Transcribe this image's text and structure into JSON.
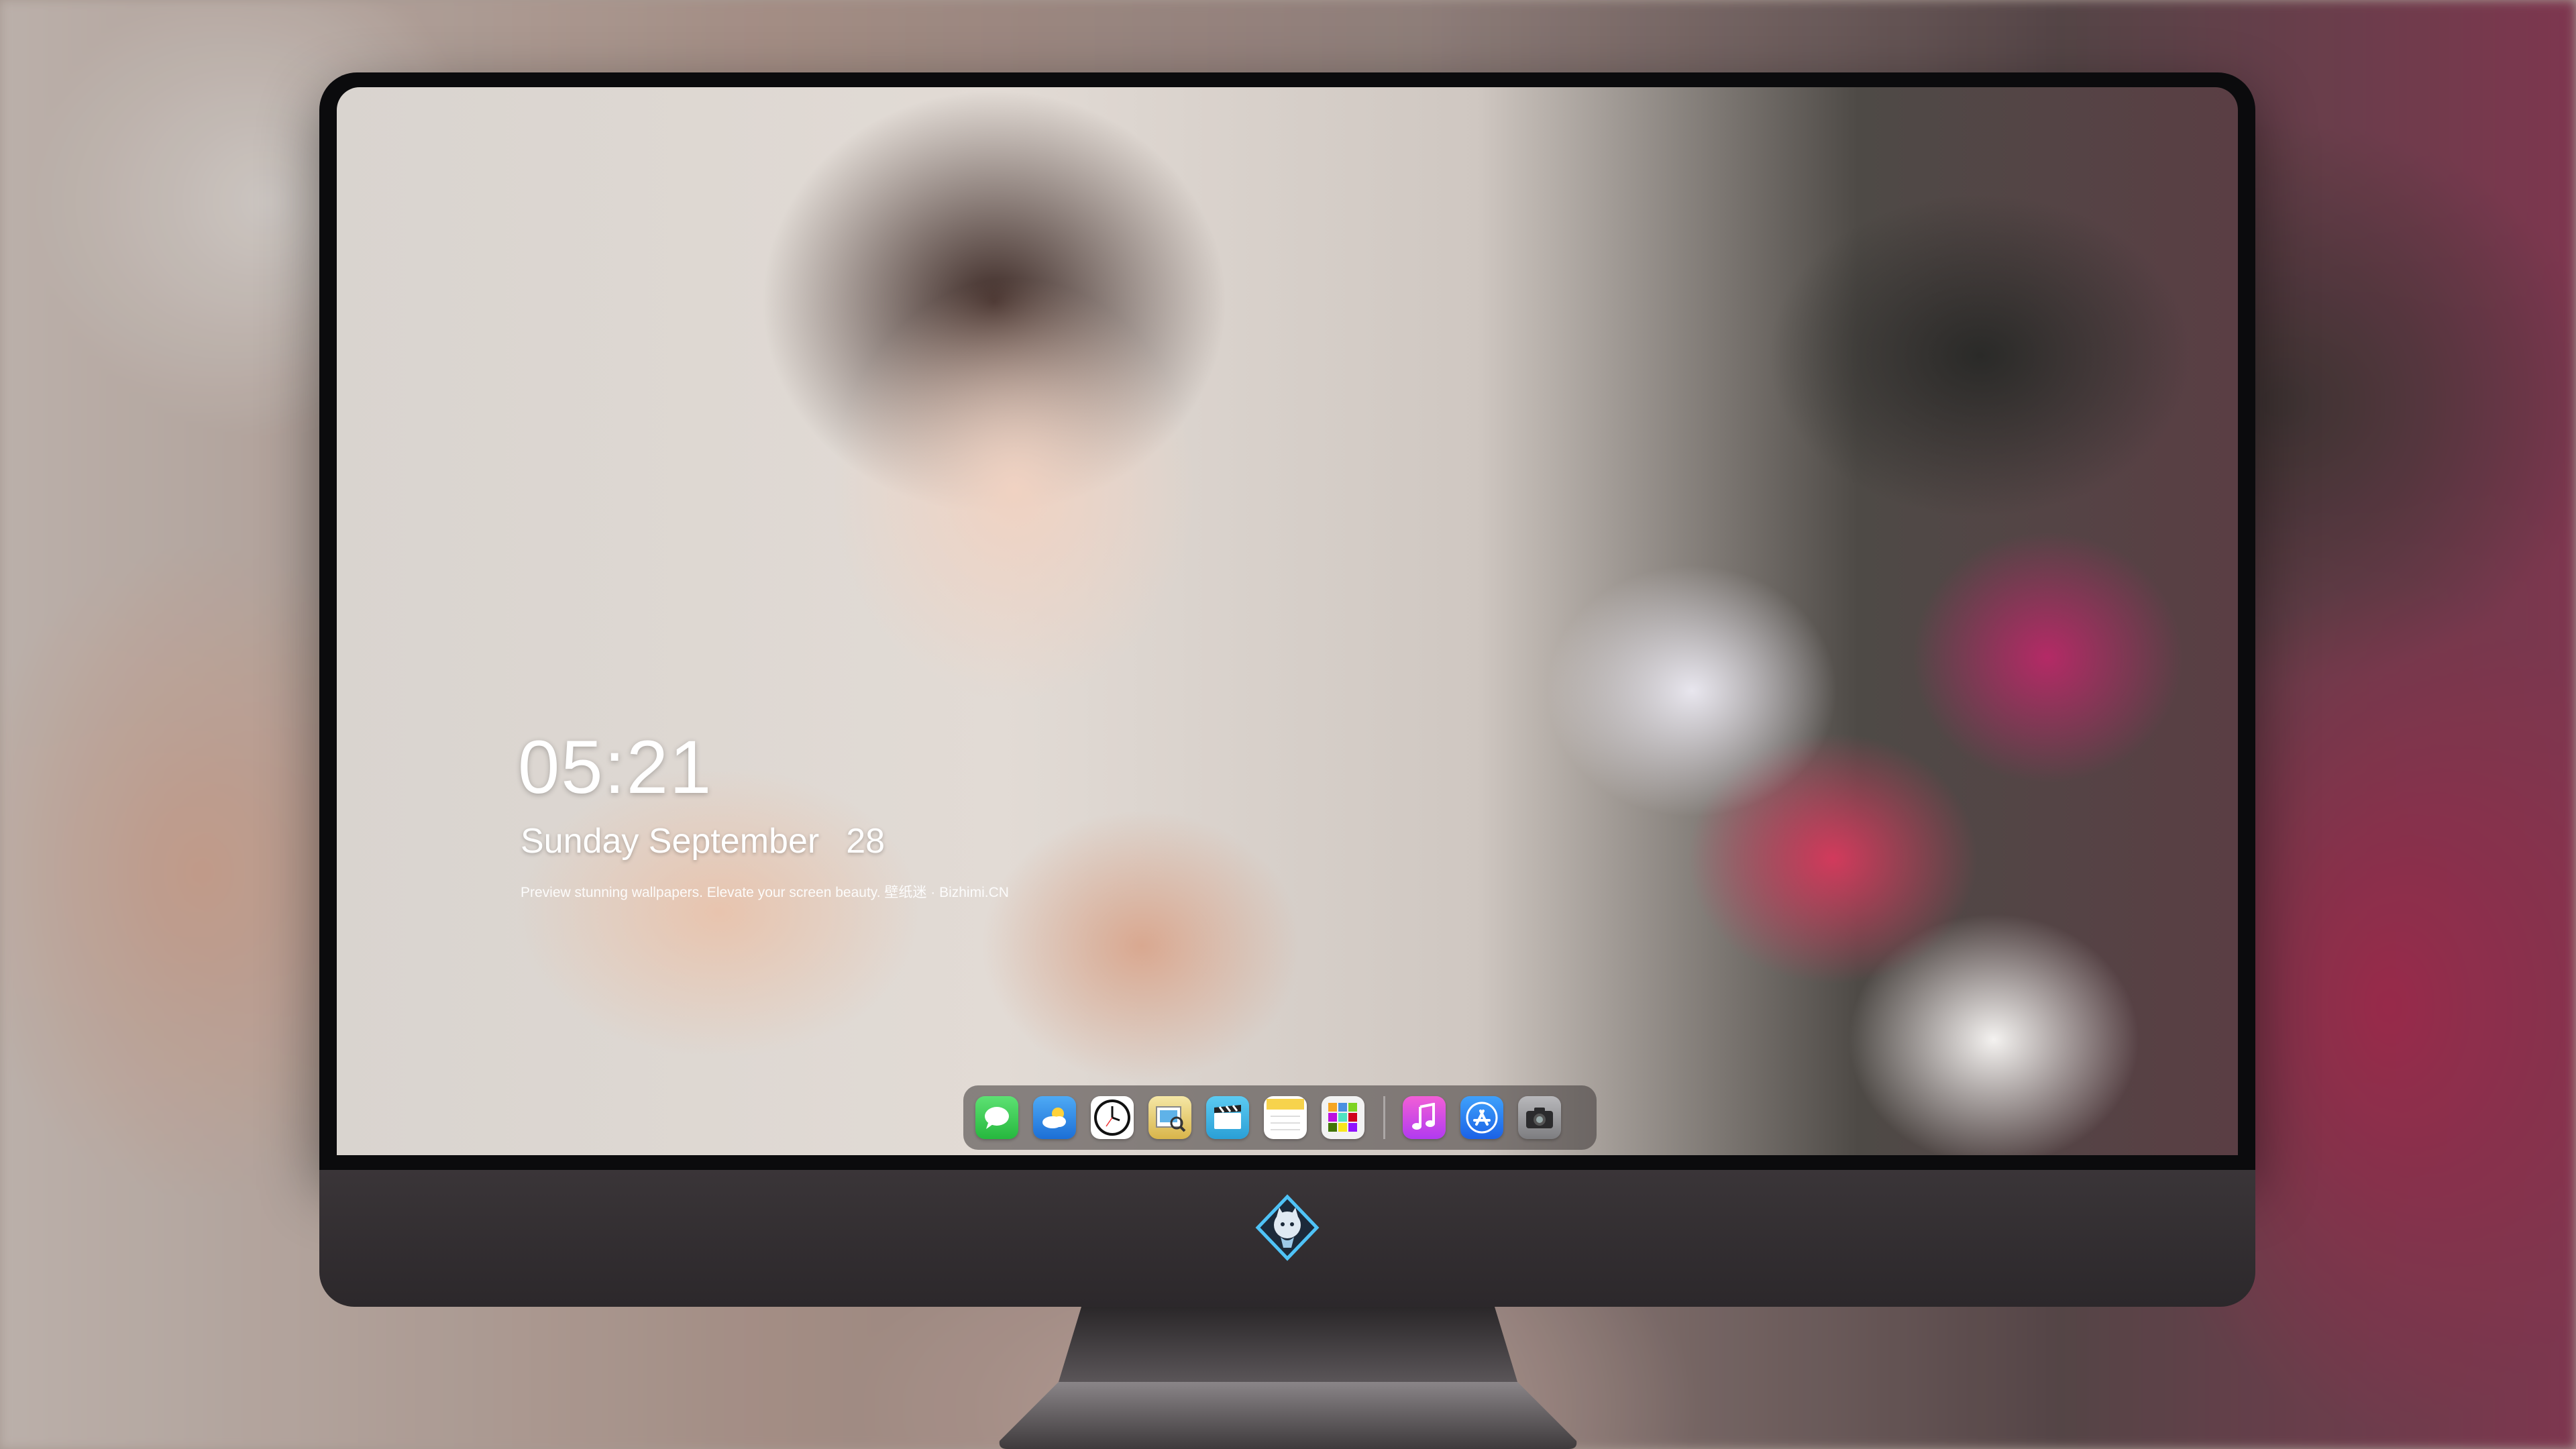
{
  "lockscreen": {
    "time": "05:21",
    "weekday_month": "Sunday September",
    "day": "28",
    "tagline": "Preview stunning wallpapers. Elevate your screen beauty. 壁纸迷 · Bizhimi.CN"
  },
  "dock": {
    "apps": [
      {
        "icon": "messages-icon",
        "color": "#2fc84a"
      },
      {
        "icon": "weather-icon",
        "color": "#2a8ce6"
      },
      {
        "icon": "clock-icon",
        "color": "#111111"
      },
      {
        "icon": "preview-icon",
        "color": "#e9d26a"
      },
      {
        "icon": "clips-icon",
        "color": "#39b4e6"
      },
      {
        "icon": "notes-icon",
        "color": "#f6d54a"
      },
      {
        "icon": "photos-grid-icon",
        "color": "#f2f2f2"
      }
    ],
    "recent_apps": [
      {
        "icon": "music-icon",
        "color": "#e040c8"
      },
      {
        "icon": "app-store-icon",
        "color": "#2a7cf0"
      },
      {
        "icon": "camera-icon",
        "color": "#8f8f92"
      }
    ]
  },
  "colors": {
    "bezel": "#0b0b0d",
    "chin": "#2c282b",
    "dock_background": "#3c3737"
  }
}
